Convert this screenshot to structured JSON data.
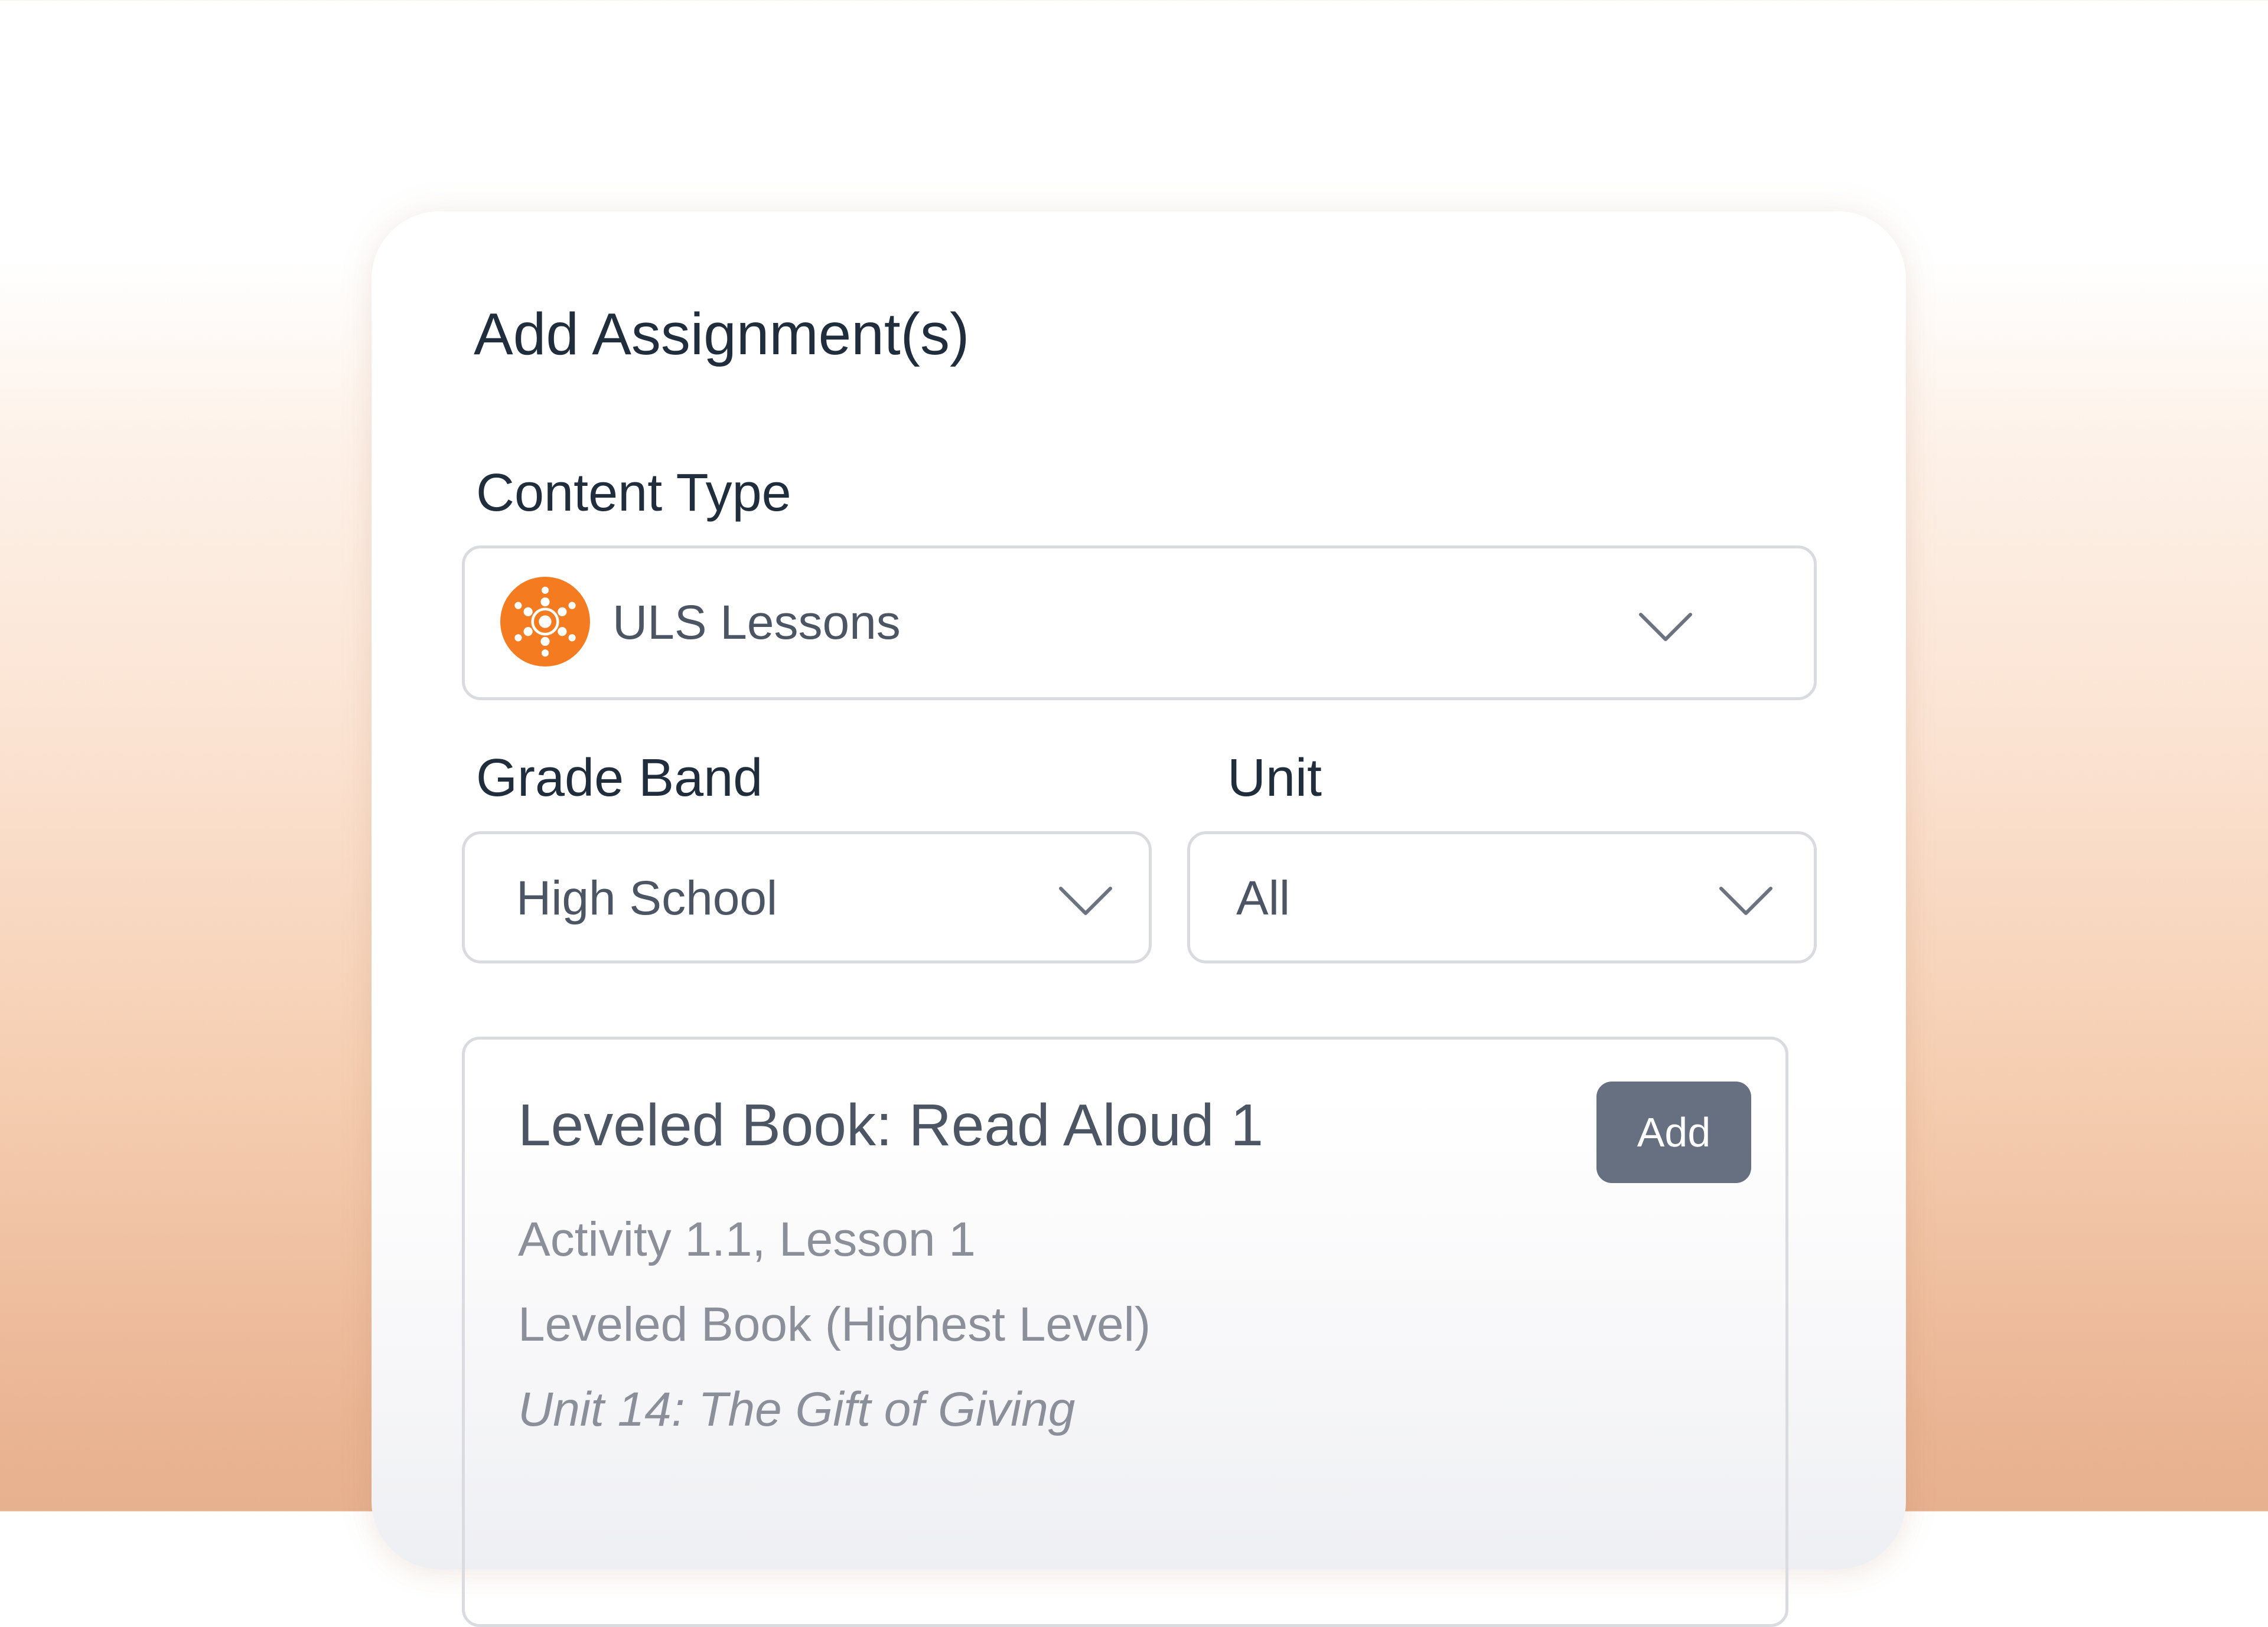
{
  "dialog": {
    "title": "Add Assignment(s)"
  },
  "content_type": {
    "label": "Content Type",
    "value": "ULS Lessons",
    "icon": "uls-brand-icon",
    "icon_color": "#f47b20"
  },
  "grade_band": {
    "label": "Grade Band",
    "value": "High School"
  },
  "unit": {
    "label": "Unit",
    "value": "All"
  },
  "result": {
    "title": "Leveled Book: Read Aloud 1",
    "activity": "Activity 1.1, Lesson 1",
    "book": "Leveled Book (Highest Level)",
    "unit": "Unit 14: The Gift of Giving",
    "add_label": "Add",
    "add_color": "#677081"
  }
}
